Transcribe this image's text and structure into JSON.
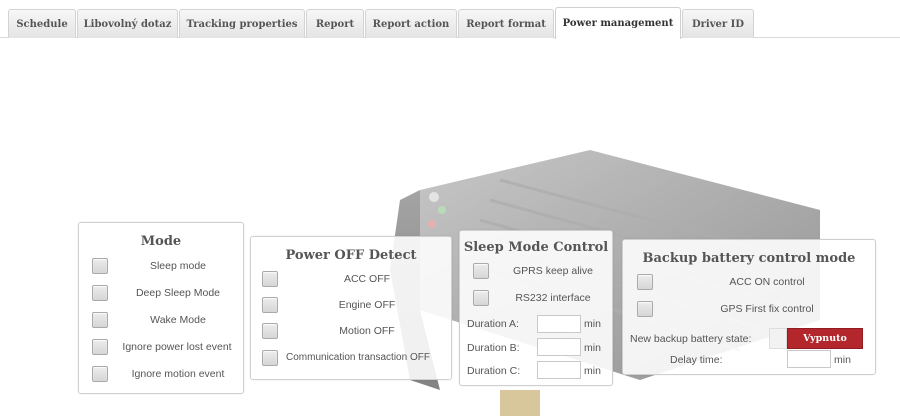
{
  "tabs": [
    {
      "label": "Schedule",
      "active": false
    },
    {
      "label": "Libovolný dotaz",
      "active": false
    },
    {
      "label": "Tracking properties",
      "active": false
    },
    {
      "label": "Report",
      "active": false
    },
    {
      "label": "Report action",
      "active": false
    },
    {
      "label": "Report format",
      "active": false
    },
    {
      "label": "Power management",
      "active": true
    },
    {
      "label": "Driver ID",
      "active": false
    }
  ],
  "mode": {
    "title": "Mode",
    "options": [
      {
        "label": "Sleep mode",
        "checked": false
      },
      {
        "label": "Deep Sleep Mode",
        "checked": false
      },
      {
        "label": "Wake Mode",
        "checked": false
      },
      {
        "label": "Ignore power lost event",
        "checked": false
      },
      {
        "label": "Ignore motion event",
        "checked": false
      }
    ]
  },
  "power_off_detect": {
    "title": "Power OFF Detect",
    "options": [
      {
        "label": "ACC OFF",
        "checked": false
      },
      {
        "label": "Engine OFF",
        "checked": false
      },
      {
        "label": "Motion OFF",
        "checked": false
      },
      {
        "label": "Communication transaction OFF",
        "checked": false
      }
    ]
  },
  "sleep_mode_control": {
    "title": "Sleep Mode Control",
    "options": [
      {
        "label": "GPRS keep alive",
        "checked": false
      },
      {
        "label": "RS232 interface",
        "checked": false
      }
    ],
    "durations": [
      {
        "label": "Duration A:",
        "value": "",
        "unit": "min"
      },
      {
        "label": "Duration B:",
        "value": "",
        "unit": "min"
      },
      {
        "label": "Duration C:",
        "value": "",
        "unit": "min"
      }
    ]
  },
  "backup_battery": {
    "title": "Backup battery control mode",
    "options": [
      {
        "label": "ACC ON control",
        "checked": false
      },
      {
        "label": "GPS First fix control",
        "checked": false
      }
    ],
    "state_label": "New backup battery state:",
    "state_value": "Vypnuto",
    "state_color": "#b3262b",
    "delay_label": "Delay time:",
    "delay_value": "",
    "delay_unit": "min"
  }
}
